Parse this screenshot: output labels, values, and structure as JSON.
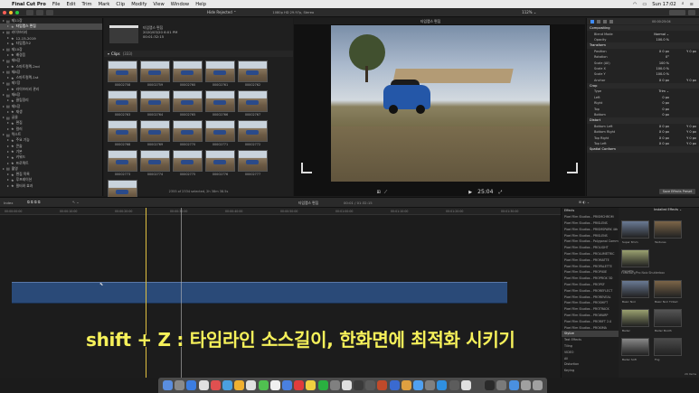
{
  "menubar": {
    "app": "Final Cut Pro",
    "items": [
      "File",
      "Edit",
      "Trim",
      "Mark",
      "Clip",
      "Modify",
      "View",
      "Window",
      "Help"
    ],
    "clock": "Sun 17:02"
  },
  "toolbar": {
    "filter": "Hide Rejected ⌃",
    "viewer_fmt": "1080p HD 29.97p, Stereo",
    "zoom": "112% ⌄"
  },
  "sidebar": {
    "rows": [
      {
        "label": "제11장",
        "depth": 0,
        "sel": false
      },
      {
        "label": "타임랩스 편집",
        "depth": 1,
        "sel": true
      },
      {
        "label": "라이브러리",
        "depth": 0,
        "sel": false
      },
      {
        "label": "12-15-2019",
        "depth": 1,
        "sel": false
      },
      {
        "label": "타임랩스2",
        "depth": 1,
        "sel": false
      },
      {
        "label": "제10장",
        "depth": 0,
        "sel": false
      },
      {
        "label": "배경음",
        "depth": 1,
        "sel": false
      },
      {
        "label": "제9장",
        "depth": 0,
        "sel": false
      },
      {
        "label": "스마트컬렉-2nd",
        "depth": 1,
        "sel": false
      },
      {
        "label": "제8장",
        "depth": 0,
        "sel": false
      },
      {
        "label": "스마트컬렉-1st",
        "depth": 1,
        "sel": false
      },
      {
        "label": "제7장",
        "depth": 0,
        "sel": false
      },
      {
        "label": "라이브러리 관리",
        "depth": 1,
        "sel": false
      },
      {
        "label": "제6장",
        "depth": 0,
        "sel": false
      },
      {
        "label": "클립정리",
        "depth": 1,
        "sel": false
      },
      {
        "label": "제5장",
        "depth": 0,
        "sel": false
      },
      {
        "label": "재생",
        "depth": 1,
        "sel": false
      },
      {
        "label": "글꼴",
        "depth": 0,
        "sel": false
      },
      {
        "label": "편집",
        "depth": 1,
        "sel": false
      },
      {
        "label": "컬러",
        "depth": 1,
        "sel": false
      },
      {
        "label": "텍스트",
        "depth": 0,
        "sel": false
      },
      {
        "label": "주요 기능",
        "depth": 1,
        "sel": false
      },
      {
        "label": "콘솔",
        "depth": 1,
        "sel": false
      },
      {
        "label": "기본",
        "depth": 1,
        "sel": false
      },
      {
        "label": "키워드",
        "depth": 1,
        "sel": false
      },
      {
        "label": "프로젝트",
        "depth": 1,
        "sel": false
      },
      {
        "label": "촬영",
        "depth": 0,
        "sel": false
      },
      {
        "label": "편집 목록",
        "depth": 1,
        "sel": false
      },
      {
        "label": "루프레이션",
        "depth": 1,
        "sel": false
      },
      {
        "label": "필터와 효과",
        "depth": 1,
        "sel": false
      }
    ]
  },
  "browser": {
    "project_info": [
      "타임랩스 편집",
      "2020/03/20 6:01 PM",
      "00:01:32:15"
    ],
    "clips_header": "Clips",
    "clips_count": "(333)",
    "clips": [
      "00002758",
      "00002759",
      "00002760",
      "00002761",
      "00002762",
      "00002763",
      "00002764",
      "00002765",
      "00002766",
      "00002767",
      "00002768",
      "00002769",
      "00002770",
      "00002771",
      "00002772",
      "00002773",
      "00002774",
      "00002775",
      "00002776",
      "00002777",
      "00002778"
    ],
    "status": "2355 of 2334 selected, 2h 38m 38.5s"
  },
  "viewer": {
    "title": "타임랩스 편집",
    "timecode": "25:04",
    "small_tc": "00:00:25:04"
  },
  "inspector": {
    "project_tc": "00:00:25:04",
    "sections": [
      {
        "title": "Compositing",
        "rows": [
          [
            "Blend Mode",
            "Normal ⌄",
            ""
          ],
          [
            "Opacity",
            "100.0 %",
            ""
          ]
        ]
      },
      {
        "title": "Transform",
        "rows": [
          [
            "Position",
            "X 0 px",
            "Y 0 px"
          ],
          [
            "Rotation",
            "0°",
            ""
          ],
          [
            "Scale (All)",
            "100 %",
            ""
          ],
          [
            "Scale X",
            "100.0 %",
            ""
          ],
          [
            "Scale Y",
            "100.0 %",
            ""
          ],
          [
            "Anchor",
            "X 0 px",
            "Y 0 px"
          ]
        ]
      },
      {
        "title": "Crop",
        "rows": [
          [
            "Type",
            "Trim ⌄",
            ""
          ],
          [
            "Left",
            "0 px",
            ""
          ],
          [
            "Right",
            "0 px",
            ""
          ],
          [
            "Top",
            "0 px",
            ""
          ],
          [
            "Bottom",
            "0 px",
            ""
          ]
        ]
      },
      {
        "title": "Distort",
        "rows": [
          [
            "Bottom Left",
            "X 0 px",
            "Y 0 px"
          ],
          [
            "Bottom Right",
            "X 0 px",
            "Y 0 px"
          ],
          [
            "Top Right",
            "X 0 px",
            "Y 0 px"
          ],
          [
            "Top Left",
            "X 0 px",
            "Y 0 px"
          ]
        ]
      },
      {
        "title": "Spatial Conform",
        "rows": []
      }
    ],
    "save_preset": "Save Effects Preset"
  },
  "timeline": {
    "index_label": "Index",
    "project": "타임랩스 편집",
    "duration": "00:01 / 01:32:15",
    "ticks": [
      "00:00:00:00",
      "00:00:10:00",
      "00:00:20:00",
      "00:00:30:00",
      "00:00:40:00",
      "00:00:50:00",
      "00:01:00:00",
      "00:01:10:00",
      "00:01:20:00",
      "00:01:30:00"
    ],
    "caption": "shift + Z : 타임라인 소스길이, 한화면에 최적화 시키기"
  },
  "effects": {
    "tabs": [
      "Effects",
      "Installed Effects ⌄"
    ],
    "list": [
      "Pixel Film Studios - PRISMCHROM",
      "Pixel Film Studios - PRISLENS",
      "Pixel Film Studios - PRISMSPARK 4th",
      "Pixel Film Studios - PRISLENS",
      "Pixel Film Studios - Polygonal Commun",
      "Pixel Film Studios - PROLIGHT",
      "Pixel Film Studios - PROLUMETRIC",
      "Pixel Film Studios - PROMATTE",
      "Pixel Film Studios - PROPALETTE",
      "Pixel Film Studios - PROPIXIE",
      "Pixel Film Studios - PROPROX 3D",
      "Pixel Film Studios - PROPSF",
      "Pixel Film Studios - PROREFLECT",
      "Pixel Film Studios - PROREVEAL",
      "Pixel Film Studios - PROSHIFT",
      "Pixel Film Studios - PROTRACK",
      "Pixel Film Studios - PROWARP",
      "Pixel Film Studios - PRORIFT 2.0",
      "Pixel Film Studios - PROXIMA",
      "Stylize",
      "Text Effects",
      "Tiling",
      "VIDEO",
      "All",
      "Distortion",
      "Keying"
    ],
    "selected": "Stylize",
    "thumbs": [
      {
        "cap": "Super 8mm"
      },
      {
        "cap": "Textures"
      },
      {
        "cap": "Vignette"
      }
    ],
    "group": "FxFactory/Pro Noiz Shutterbox",
    "thumbs2": [
      {
        "cap": "Basic Noir"
      },
      {
        "cap": "Basic Noir Tinted"
      },
      {
        "cap": "Bader"
      },
      {
        "cap": "Bader Booth"
      },
      {
        "cap": "Bader Soft"
      },
      {
        "cap": "Fog"
      }
    ],
    "count": "29 items"
  },
  "dock": {
    "colors": [
      "#5a8ee0",
      "#8a8a8a",
      "#3c7de0",
      "#e0e0e0",
      "#e05050",
      "#4aa0e0",
      "#f0b030",
      "#e0e0e0",
      "#50c050",
      "#f0f0f0",
      "#4a80e0",
      "#e03c3c",
      "#f0d040",
      "#2ab040",
      "#808080",
      "#e0e0e0",
      "#3a3a3a",
      "#5a5a5a",
      "#c04a2a",
      "#3a6ad0",
      "#e0a040",
      "#50a0f0",
      "#808080",
      "#3090e0",
      "#5c5c5c",
      "#e0e0e0",
      "#4a4a4a",
      "#2a2a2a",
      "#7a7a7a",
      "#4a90e0",
      "#a0a0a0",
      "#a0a0a0"
    ]
  }
}
